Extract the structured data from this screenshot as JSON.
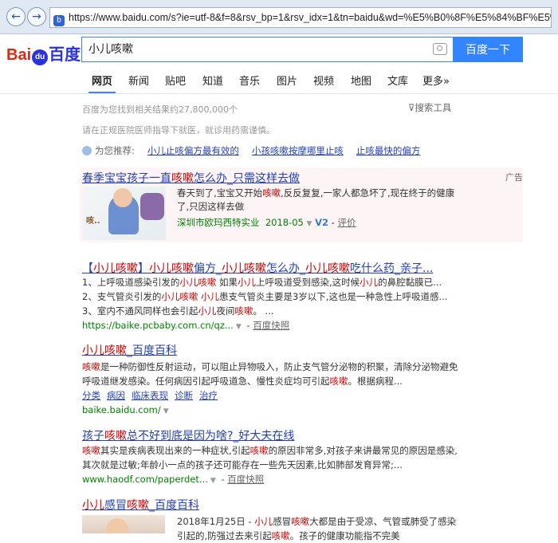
{
  "browser": {
    "url": "https://www.baidu.com/s?ie=utf-8&f=8&rsv_bp=1&rsv_idx=1&tn=baidu&wd=%E5%B0%8F%E5%84%BF%E5%92"
  },
  "header": {
    "logo_left": "Bai",
    "logo_paw": "du",
    "logo_right": "百度",
    "query": "小儿咳嗽",
    "search_button": "百度一下"
  },
  "tabs": [
    "网页",
    "新闻",
    "贴吧",
    "知道",
    "音乐",
    "图片",
    "视频",
    "地图",
    "文库",
    "更多»"
  ],
  "meta": {
    "result_count": "百度为您找到相关结果约27,800,000个",
    "tools": "搜索工具",
    "medical_tip": "请在正规医院医师指导下就医，就诊用药需谨慎。"
  },
  "recommend": {
    "label": "为您推荐:",
    "links": [
      "小儿止咳偏方最有效的",
      "小孩咳嗽按摩哪里止咳",
      "止咳最快的偏方"
    ]
  },
  "ad": {
    "label": "广告",
    "img_text": "咳..",
    "title_a": "春季宝宝孩子一直",
    "title_em": "咳嗽",
    "title_b": "怎么办_只需这样去做",
    "desc_a": "春天到了,宝宝又开始",
    "desc_em": "咳嗽",
    "desc_b": ",反反复复,一家人都急坏了,现在终于的健康",
    "desc_line2": "了,只因这样去做",
    "source": "深圳市欧玛西特实业",
    "date": "2018-05",
    "v2": "V2",
    "review": "评价"
  },
  "results": [
    {
      "title": "【小儿咳嗽】小儿咳嗽偏方_小儿咳嗽怎么办_小儿咳嗽吃什么药_亲子...",
      "lines": [
        "1、上呼吸道感染引发的小儿咳嗽 如果小儿上呼吸道受到感染,这时候小儿的鼻腔黏膜已...",
        "2、支气管炎引发的小儿咳嗽 小儿患支气管炎主要是3岁以下,这也是一种急性上呼吸道感...",
        "3、室内不通风同样也会引起小儿夜间咳嗽。 ..."
      ],
      "url": "https://baike.pcbaby.com.cn/qz...",
      "snapshot": "百度快照"
    },
    {
      "title": "小儿咳嗽_百度百科",
      "lines": [
        "咳嗽是一种防御性反射运动，可以阻止异物吸入，防止支气管分泌物的积聚，清除分泌物避免",
        "呼吸道继发感染。任何病因引起呼吸道急、慢性炎症均可引起咳嗽。根据病程..."
      ],
      "links": [
        "分类",
        "病因",
        "临床表现",
        "诊断",
        "治疗"
      ],
      "url": "baike.baidu.com/"
    },
    {
      "title": "孩子咳嗽总不好到底是因为啥?_好大夫在线",
      "lines": [
        "咳嗽其实是疾病表现出来的一种症状,引起咳嗽的原因非常多,对孩子来讲最常见的原因是感染,",
        "其次就是过敏;年龄小一点的孩子还可能存在一些先天因素,比如肺部发育异常;..."
      ],
      "url": "www.haodf.com/paperdet...",
      "snapshot": "百度快照"
    },
    {
      "title": "小儿感冒咳嗽_百度百科",
      "lines": [
        "2018年1月25日 - 小儿感冒咳嗽大都是由于受凉、气管或肺受了感染",
        "引起的,防强过去来引起咳嗽。孩子的健康功能指不完美"
      ]
    }
  ],
  "colors": {
    "link": "#2440b3",
    "highlight": "#cc0000",
    "url": "#008000",
    "brand_blue": "#3385ff"
  }
}
